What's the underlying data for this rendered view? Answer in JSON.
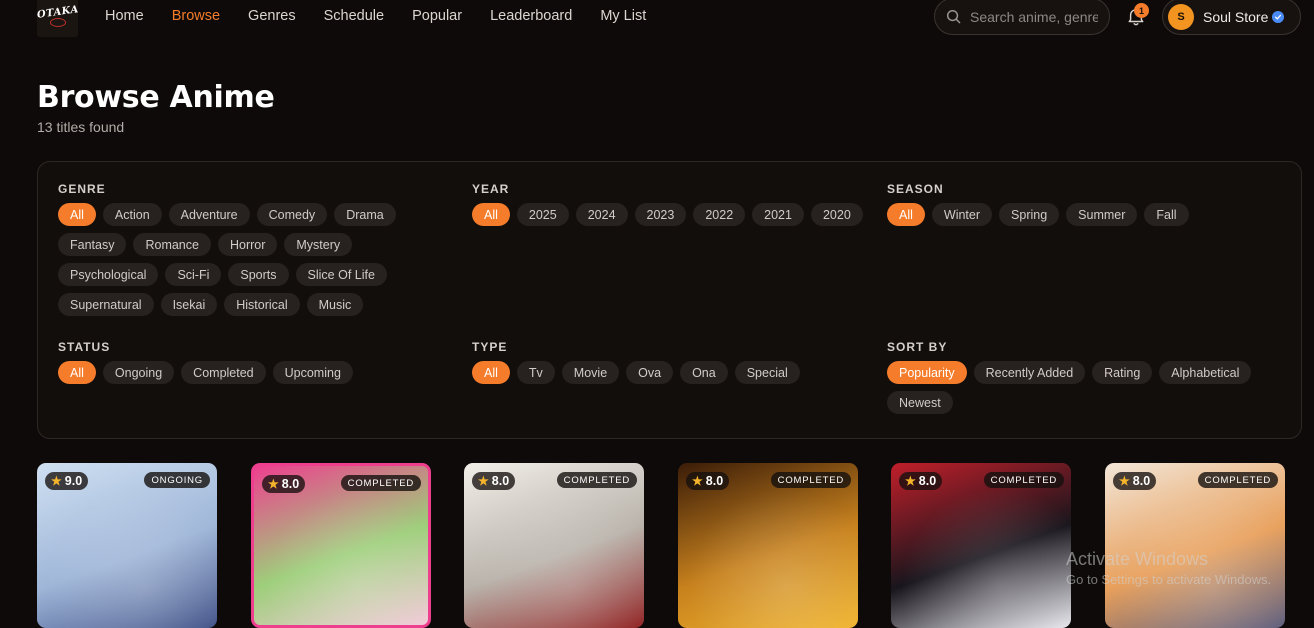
{
  "brand": {
    "logo_text": "OTAKA"
  },
  "nav": {
    "links": [
      "Home",
      "Browse",
      "Genres",
      "Schedule",
      "Popular",
      "Leaderboard",
      "My List"
    ],
    "active": "Browse"
  },
  "search": {
    "placeholder": "Search anime, genres..."
  },
  "notifications": {
    "count": "1"
  },
  "user": {
    "initial": "S",
    "name": "Soul Store",
    "verified": true
  },
  "page": {
    "title": "Browse Anime",
    "subtitle": "13 titles found"
  },
  "filters": {
    "genre": {
      "label": "GENRE",
      "options": [
        "All",
        "Action",
        "Adventure",
        "Comedy",
        "Drama",
        "Fantasy",
        "Romance",
        "Horror",
        "Mystery",
        "Psychological",
        "Sci-Fi",
        "Sports",
        "Slice Of Life",
        "Supernatural",
        "Isekai",
        "Historical",
        "Music"
      ],
      "selected": "All"
    },
    "year": {
      "label": "YEAR",
      "options": [
        "All",
        "2025",
        "2024",
        "2023",
        "2022",
        "2021",
        "2020"
      ],
      "selected": "All"
    },
    "season": {
      "label": "SEASON",
      "options": [
        "All",
        "Winter",
        "Spring",
        "Summer",
        "Fall"
      ],
      "selected": "All"
    },
    "status": {
      "label": "STATUS",
      "options": [
        "All",
        "Ongoing",
        "Completed",
        "Upcoming"
      ],
      "selected": "All"
    },
    "type": {
      "label": "TYPE",
      "options": [
        "All",
        "Tv",
        "Movie",
        "Ova",
        "Ona",
        "Special"
      ],
      "selected": "All"
    },
    "sort": {
      "label": "SORT BY",
      "options": [
        "Popularity",
        "Recently Added",
        "Rating",
        "Alphabetical",
        "Newest"
      ],
      "selected": "Popularity"
    }
  },
  "cards": [
    {
      "rating": "9.0",
      "status": "ONGOING",
      "colors": [
        "#cfe0f2",
        "#9fb6d8",
        "#3e4f86"
      ]
    },
    {
      "rating": "8.0",
      "status": "COMPLETED",
      "colors": [
        "#ee3f8f",
        "#9dcf7a",
        "#f2c9d8"
      ]
    },
    {
      "rating": "8.0",
      "status": "COMPLETED",
      "colors": [
        "#f2efe9",
        "#b9b3ab",
        "#8e1d1d"
      ]
    },
    {
      "rating": "8.0",
      "status": "COMPLETED",
      "colors": [
        "#3a1c08",
        "#c7811d",
        "#f0b42d"
      ]
    },
    {
      "rating": "8.0",
      "status": "COMPLETED",
      "colors": [
        "#c11f2a",
        "#18151c",
        "#e8e8ee"
      ]
    },
    {
      "rating": "8.0",
      "status": "COMPLETED",
      "colors": [
        "#f2e6d8",
        "#e8a05c",
        "#5a5a7a"
      ]
    }
  ],
  "os_watermark": {
    "line1": "Activate Windows",
    "line2": "Go to Settings to activate Windows."
  },
  "accent": "#f57c2a"
}
